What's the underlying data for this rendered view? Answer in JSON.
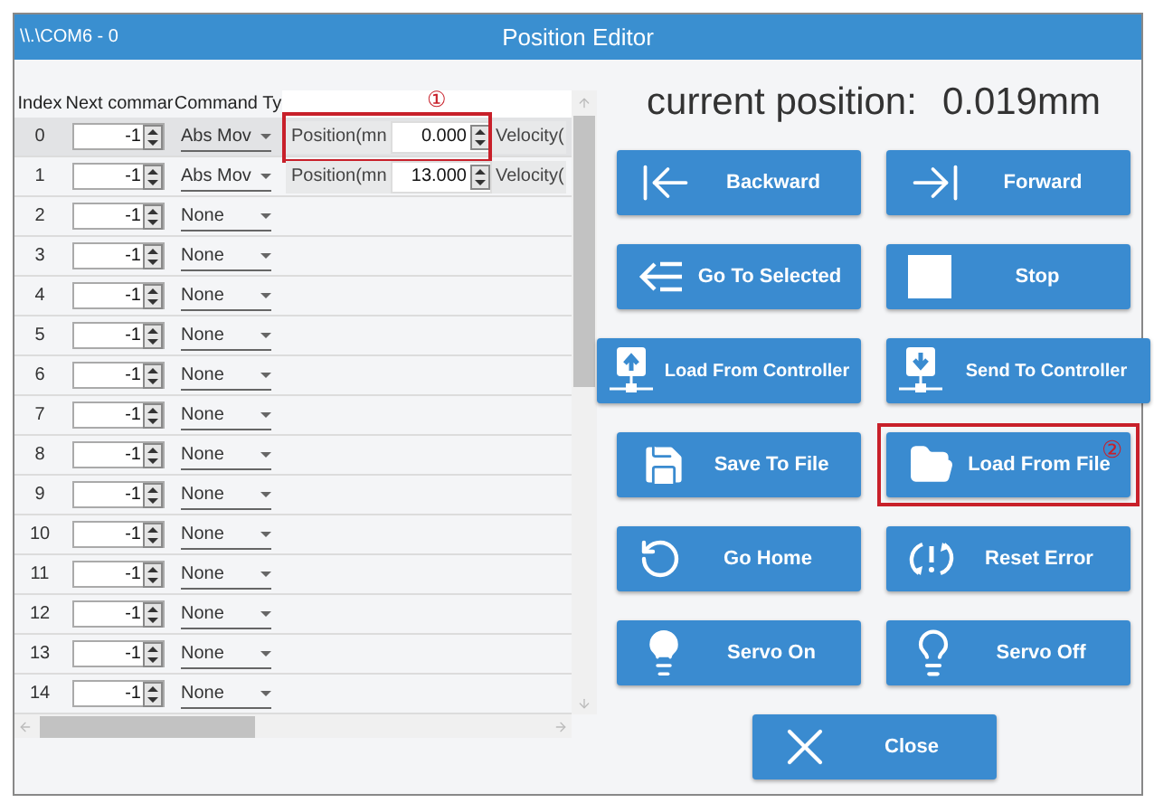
{
  "window": {
    "port": "\\\\.\\COM6 - 0",
    "title": "Position Editor"
  },
  "table": {
    "columns": [
      "Index",
      "Next commar",
      "Command Ty"
    ],
    "rows": [
      {
        "index": "0",
        "next": "-1",
        "command": "Abs Mov",
        "selected": true,
        "params": [
          {
            "label": "Position(mn",
            "value": "0.000",
            "callout": "①"
          },
          {
            "label": "Velocity("
          }
        ]
      },
      {
        "index": "1",
        "next": "-1",
        "command": "Abs Mov",
        "selected": false,
        "params": [
          {
            "label": "Position(mn",
            "value": "13.000"
          },
          {
            "label": "Velocity("
          }
        ]
      },
      {
        "index": "2",
        "next": "-1",
        "command": "None",
        "selected": false
      },
      {
        "index": "3",
        "next": "-1",
        "command": "None",
        "selected": false
      },
      {
        "index": "4",
        "next": "-1",
        "command": "None",
        "selected": false
      },
      {
        "index": "5",
        "next": "-1",
        "command": "None",
        "selected": false
      },
      {
        "index": "6",
        "next": "-1",
        "command": "None",
        "selected": false
      },
      {
        "index": "7",
        "next": "-1",
        "command": "None",
        "selected": false
      },
      {
        "index": "8",
        "next": "-1",
        "command": "None",
        "selected": false
      },
      {
        "index": "9",
        "next": "-1",
        "command": "None",
        "selected": false
      },
      {
        "index": "10",
        "next": "-1",
        "command": "None",
        "selected": false
      },
      {
        "index": "11",
        "next": "-1",
        "command": "None",
        "selected": false
      },
      {
        "index": "12",
        "next": "-1",
        "command": "None",
        "selected": false
      },
      {
        "index": "13",
        "next": "-1",
        "command": "None",
        "selected": false
      },
      {
        "index": "14",
        "next": "-1",
        "command": "None",
        "selected": false
      }
    ]
  },
  "position": {
    "label": "current position:",
    "value": "0.019mm"
  },
  "button_rows": [
    [
      {
        "kind": "backward",
        "label": "Backward"
      },
      {
        "kind": "forward",
        "label": "Forward"
      }
    ],
    [
      {
        "kind": "goto",
        "label": "Go To Selected"
      },
      {
        "kind": "stop",
        "label": "Stop"
      }
    ],
    [
      {
        "kind": "upload",
        "label": "Load From Controller"
      },
      {
        "kind": "download",
        "label": "Send To Controller"
      }
    ],
    [
      {
        "kind": "save",
        "label": "Save To File"
      },
      {
        "kind": "open",
        "label": "Load From File",
        "callout": "②"
      }
    ],
    [
      {
        "kind": "home",
        "label": "Go Home"
      },
      {
        "kind": "reset",
        "label": "Reset Error"
      }
    ],
    [
      {
        "kind": "servo_on",
        "label": "Servo On"
      },
      {
        "kind": "servo_off",
        "label": "Servo Off"
      }
    ],
    [
      {
        "kind": "close",
        "label": "Close"
      }
    ]
  ]
}
